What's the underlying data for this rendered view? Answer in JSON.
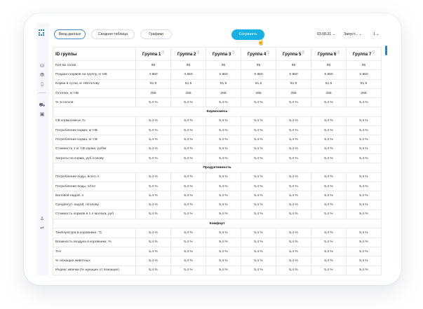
{
  "toolbar": {
    "tabs": [
      {
        "label": "Ввод данных",
        "active": true
      },
      {
        "label": "Сводная таблица",
        "active": false
      },
      {
        "label": "Графики",
        "active": false
      }
    ],
    "save_label": "Сохранить",
    "date": "03.08.21",
    "launch": "Запуст...",
    "page": "1"
  },
  "table": {
    "id_header": "ID группы",
    "groups": [
      "Группа 1",
      "Группа 2",
      "Группа 3",
      "Группа 4",
      "Группа 5",
      "Группа 6",
      "Группа 7"
    ],
    "rows": [
      {
        "label": "Кол-во голов",
        "values": [
          "95",
          "95",
          "95",
          "95",
          "95",
          "95",
          "95"
        ]
      },
      {
        "label": "Роздано кормов на группу, кг НВ",
        "values": [
          "4 860",
          "4 860",
          "5 860",
          "5 860",
          "5 860",
          "5 860",
          "5 860"
        ]
      },
      {
        "label": "Корма в сутки, кг НВ/голову",
        "values": [
          "51,5",
          "51,5",
          "51,5",
          "51,5",
          "51,5",
          "51,5",
          "51,5"
        ]
      },
      {
        "label": "Остатки, кг НВ",
        "values": [
          "265",
          "265",
          "265",
          "265",
          "265",
          "265",
          "265"
        ]
      },
      {
        "label": "% остатков",
        "values": [
          "5,4 %",
          "5,4 %",
          "5,4 %",
          "5,4 %",
          "5,4 %",
          "5,4 %",
          "5,4 %"
        ]
      },
      {
        "section": "Кормосмесь"
      },
      {
        "label": "СВ кормосмеси, %",
        "values": [
          "5,4 %",
          "5,4 %",
          "5,4 %",
          "5,4 %",
          "5,4 %",
          "5,4 %",
          "5,4 %"
        ]
      },
      {
        "label": "Потребление корма, кг НВ",
        "values": [
          "5,4 %",
          "5,4 %",
          "5,4 %",
          "5,4 %",
          "5,4 %",
          "5,4 %",
          "5,4 %"
        ]
      },
      {
        "label": "Потребление корма, кг СВ",
        "values": [
          "5,4 %",
          "5,4 %",
          "5,4 %",
          "5,4 %",
          "5,4 %",
          "5,4 %",
          "5,4 %"
        ]
      },
      {
        "label": "Стоимость 1 кг СВ корма, руб/кг",
        "values": [
          "5,4 %",
          "5,4 %",
          "5,4 %",
          "5,4 %",
          "5,4 %",
          "5,4 %",
          "5,4 %"
        ]
      },
      {
        "label": "Затраты на корма, руб./голову",
        "values": [
          "5,4 %",
          "5,4 %",
          "5,4 %",
          "5,4 %",
          "5,4 %",
          "5,4 %",
          "5,4 %"
        ]
      },
      {
        "section": "Продуктивность"
      },
      {
        "label": "Потребление воды, всего л",
        "values": [
          "5,4 %",
          "5,4 %",
          "5,4 %",
          "5,4 %",
          "5,4 %",
          "5,4 %",
          "5,4 %"
        ]
      },
      {
        "label": "Потребление воды, л/гол",
        "values": [
          "5,4 %",
          "5,4 %",
          "5,4 %",
          "5,4 %",
          "5,4 %",
          "5,4 %",
          "5,4 %"
        ]
      },
      {
        "label": "Валовой надой, л",
        "values": [
          "5,4 %",
          "5,4 %",
          "5,4 %",
          "5,4 %",
          "5,4 %",
          "5,4 %",
          "5,4 %"
        ]
      },
      {
        "label": "Среднесут. надой, л/голову",
        "values": [
          "5,4 %",
          "5,4 %",
          "5,4 %",
          "5,4 %",
          "5,4 %",
          "5,4 %",
          "5,4 %"
        ]
      },
      {
        "label": "Стоимость кормов в 1 л молока, руб",
        "values": [
          "5,4 %",
          "5,4 %",
          "5,4 %",
          "5,4 %",
          "5,4 %",
          "5,4 %",
          "5,4 %"
        ]
      },
      {
        "section": "Комфорт"
      },
      {
        "label": "Температура в коровнике, °С",
        "values": [
          "5,4 %",
          "5,4 %",
          "5,4 %",
          "5,4 %",
          "5,4 %",
          "5,4 %",
          "5,4 %"
        ]
      },
      {
        "label": "Влажность воздуха в коровнике, %",
        "values": [
          "5,4 %",
          "5,4 %",
          "5,4 %",
          "5,4 %",
          "5,4 %",
          "5,4 %",
          "5,4 %"
        ]
      },
      {
        "label": "THI",
        "values": [
          "5,4 %",
          "5,4 %",
          "5,4 %",
          "5,4 %",
          "5,4 %",
          "5,4 %",
          "5,4 %"
        ]
      },
      {
        "label": "% лежащих животных",
        "values": [
          "5,4 %",
          "5,4 %",
          "5,4 %",
          "5,4 %",
          "5,4 %",
          "5,4 %",
          "5,4 %"
        ]
      },
      {
        "label": "Индекс жвачки (% жующих от лежащих)",
        "values": [
          "5,4 %",
          "5,4 %",
          "5,4 %",
          "5,4 %",
          "5,4 %",
          "5,4 %",
          "5,4 %"
        ]
      }
    ]
  },
  "colors": {
    "accent": "#19b0e6",
    "brand": "#2d7fd6"
  },
  "icons": [
    "logo-grid-icon",
    "cow-icon",
    "feed-icon",
    "bottle-icon",
    "truck-icon",
    "chart-icon",
    "user-icon",
    "settings-icon"
  ]
}
